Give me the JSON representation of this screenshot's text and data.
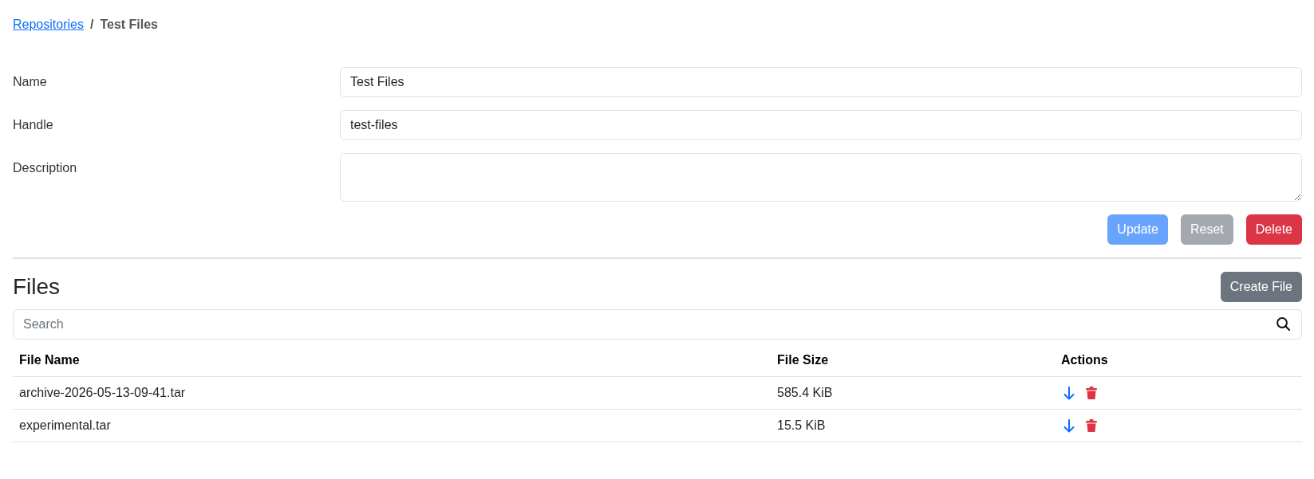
{
  "breadcrumb": {
    "separator": "/",
    "items": [
      {
        "label": "Repositories",
        "kind": "link"
      },
      {
        "label": "Test Files",
        "kind": "current"
      }
    ]
  },
  "form": {
    "fields": [
      {
        "label": "Name",
        "kind": "input",
        "value": "Test Files"
      },
      {
        "label": "Handle",
        "kind": "input",
        "value": "test-files"
      },
      {
        "label": "Description",
        "kind": "textarea"
      }
    ],
    "buttons": [
      {
        "label": "Update",
        "kind": "primary",
        "disabled": true
      },
      {
        "label": "Reset",
        "kind": "secondary",
        "disabled": true
      },
      {
        "label": "Delete",
        "kind": "danger",
        "disabled": false
      }
    ]
  },
  "files": {
    "title": "Files",
    "create_button": {
      "label": "Create File",
      "kind": "secondary",
      "disabled": false
    },
    "search": {
      "placeholder": "Search"
    },
    "table": {
      "columns": [
        "File Name",
        "File Size",
        "Actions"
      ],
      "rows": [
        {
          "file_name": "archive-2026-05-13-09-41.tar",
          "file_size": "585.4 KiB"
        },
        {
          "file_name": "experimental.tar",
          "file_size": "15.5 KiB"
        }
      ]
    }
  }
}
